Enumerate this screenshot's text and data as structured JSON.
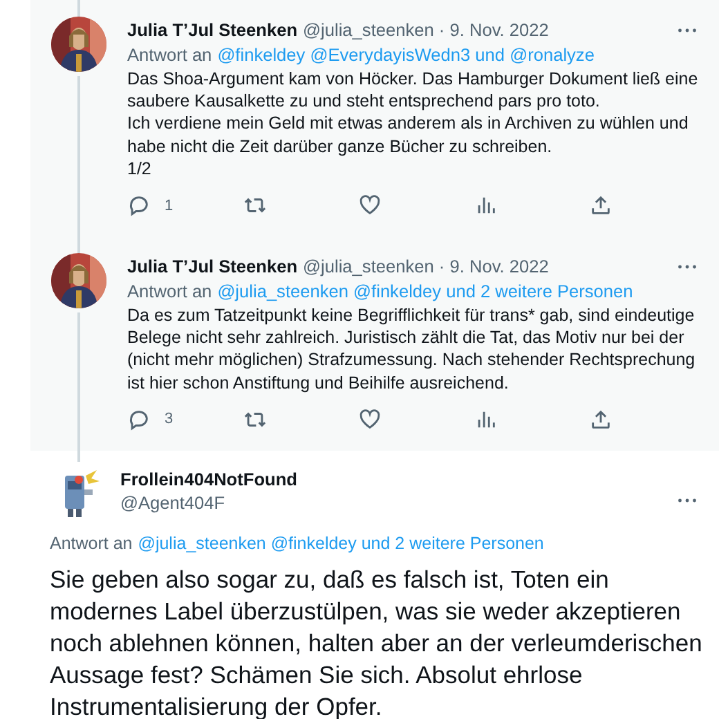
{
  "tweets": [
    {
      "kind": "context",
      "name": "Julia T’Jul Steenken",
      "meta": "@julia_steenken · 9. Nov. 2022",
      "reply_prefix": "Antwort an",
      "reply_to": "@finkeldey @EverydayisWedn3 und @ronalyze",
      "paragraphs": [
        "Das Shoa-Argument kam von Höcker. Das Hamburger Dokument ließ eine saubere Kausalkette zu und steht entsprechend pars pro toto.",
        "Ich verdiene mein Geld mit etwas anderem als in Archiven zu wühlen und habe nicht die Zeit darüber ganze Bücher zu schreiben.",
        "1/2"
      ],
      "reply_count": "1"
    },
    {
      "kind": "context",
      "name": "Julia T’Jul Steenken",
      "meta": "@julia_steenken · 9. Nov. 2022",
      "reply_prefix": "Antwort an",
      "reply_to": "@julia_steenken @finkeldey und 2 weitere Personen",
      "paragraphs": [
        "Da es zum Tatzeitpunkt keine Begrifflichkeit für trans* gab, sind eindeutige Belege nicht sehr zahlreich. Juristisch zählt die Tat, das Motiv nur bei der (nicht mehr möglichen) Strafzumessung. Nach stehender Rechtsprechung ist hier schon Anstiftung und Beihilfe ausreichend."
      ],
      "reply_count": "3"
    },
    {
      "kind": "focus",
      "name": "Frollein404NotFound",
      "meta": "@Agent404F",
      "reply_prefix": "Antwort an",
      "reply_to": "@julia_steenken @finkeldey und 2 weitere Personen",
      "paragraphs": [
        "Sie geben also sogar zu, daß es falsch ist, Toten ein modernes Label überzustülpen, was sie weder akzeptieren noch ablehnen können, halten aber an der verleumderischen Aussage fest? Schämen Sie sich. Absolut ehrlose Instrumentalisierung der Opfer."
      ]
    }
  ]
}
